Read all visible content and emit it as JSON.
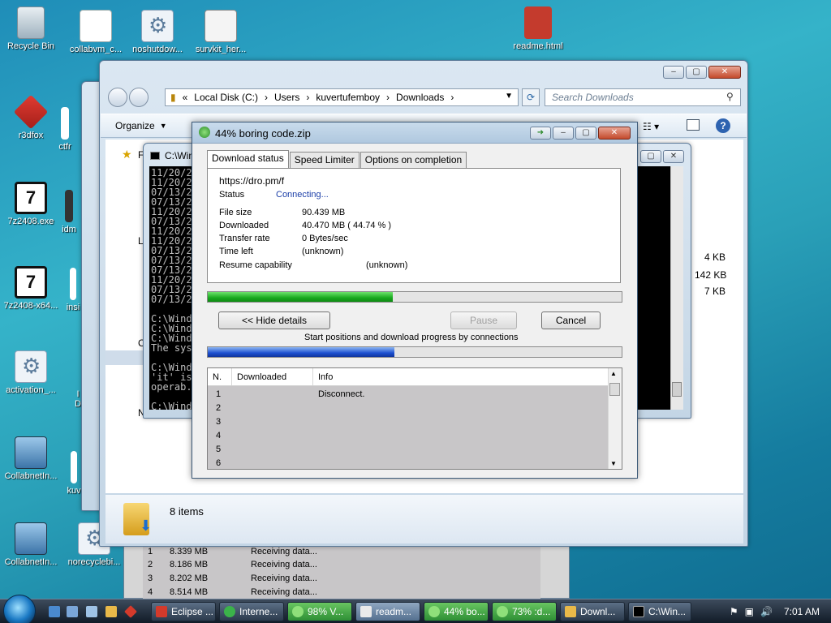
{
  "desktop_icons": [
    {
      "label": "Recycle Bin"
    },
    {
      "label": "collabvm_c..."
    },
    {
      "label": "noshutdow..."
    },
    {
      "label": "survkit_her..."
    },
    {
      "label": "readme.html"
    },
    {
      "label": "r3dfox"
    },
    {
      "label": "ctfr"
    },
    {
      "label": "7z2408.exe"
    },
    {
      "label": "idm"
    },
    {
      "label": "7z2408-x64..."
    },
    {
      "label": "insi"
    },
    {
      "label": "activation_..."
    },
    {
      "label": "I"
    },
    {
      "label": "D"
    },
    {
      "label": "CollabnetIn..."
    },
    {
      "label": "kuv"
    },
    {
      "label": "CollabnetIn..."
    },
    {
      "label": "norecyclebi..."
    }
  ],
  "explorer": {
    "breadcrumb": [
      "«",
      "Local Disk (C:)",
      "Users",
      "kuvertufemboy",
      "Downloads"
    ],
    "search_placeholder": "Search Downloads",
    "organize": "Organize",
    "sizes": [
      "4 KB",
      "142 KB",
      "7 KB"
    ],
    "status": "8 items",
    "side_letters": [
      "F",
      "L",
      "C",
      "N"
    ]
  },
  "console": {
    "title": "C:\\Win",
    "lines": [
      "11/20/2",
      "11/20/2",
      "07/13/2",
      "07/13/2",
      "11/20/2",
      "07/13/2",
      "11/20/2",
      "11/20/2",
      "07/13/2",
      "07/13/2",
      "07/13/2",
      "11/20/2",
      "07/13/2",
      "07/13/2",
      "",
      "C:\\Wind",
      "C:\\Wind",
      "C:\\Wind",
      "The sys",
      "",
      "C:\\Wind",
      "'it' is",
      "operab.",
      "",
      "C:\\Wind"
    ]
  },
  "idm": {
    "title": "44% boring code.zip",
    "tabs": [
      "Download status",
      "Speed Limiter",
      "Options on completion"
    ],
    "url": "https://dro.pm/f",
    "status_label": "Status",
    "status_value": "Connecting...",
    "fields": [
      {
        "label": "File size",
        "value": "90.439  MB"
      },
      {
        "label": "Downloaded",
        "value": "40.470  MB  ( 44.74 % )"
      },
      {
        "label": "Transfer rate",
        "value": "0  Bytes/sec"
      },
      {
        "label": "Time left",
        "value": "(unknown)"
      }
    ],
    "resume_label": "Resume capability",
    "resume_value": "(unknown)",
    "progress": 0.4474,
    "hide_details": "<< Hide details",
    "pause": "Pause",
    "cancel": "Cancel",
    "connections_label": "Start positions and download progress by connections",
    "connection_progress": 0.45,
    "columns": [
      "N.",
      "Downloaded",
      "Info"
    ],
    "rows": [
      {
        "n": "1",
        "downloaded": "",
        "info": "Disconnect."
      },
      {
        "n": "2",
        "downloaded": "",
        "info": ""
      },
      {
        "n": "3",
        "downloaded": "",
        "info": ""
      },
      {
        "n": "4",
        "downloaded": "",
        "info": ""
      },
      {
        "n": "5",
        "downloaded": "",
        "info": ""
      },
      {
        "n": "6",
        "downloaded": "",
        "info": ""
      }
    ]
  },
  "behind_list": [
    {
      "n": "1",
      "downloaded": "8.339  MB",
      "info": "Receiving data..."
    },
    {
      "n": "2",
      "downloaded": "8.186  MB",
      "info": "Receiving data..."
    },
    {
      "n": "3",
      "downloaded": "8.202  MB",
      "info": "Receiving data..."
    },
    {
      "n": "4",
      "downloaded": "8.514  MB",
      "info": "Receiving data..."
    }
  ],
  "taskbar": {
    "buttons": [
      {
        "label": "Eclipse ..."
      },
      {
        "label": "Interne..."
      },
      {
        "label": "98% V..."
      },
      {
        "label": "readm..."
      },
      {
        "label": "44% bo..."
      },
      {
        "label": "73% :d..."
      },
      {
        "label": "Downl..."
      },
      {
        "label": "C:\\Win..."
      }
    ],
    "time": "7:01 AM"
  }
}
